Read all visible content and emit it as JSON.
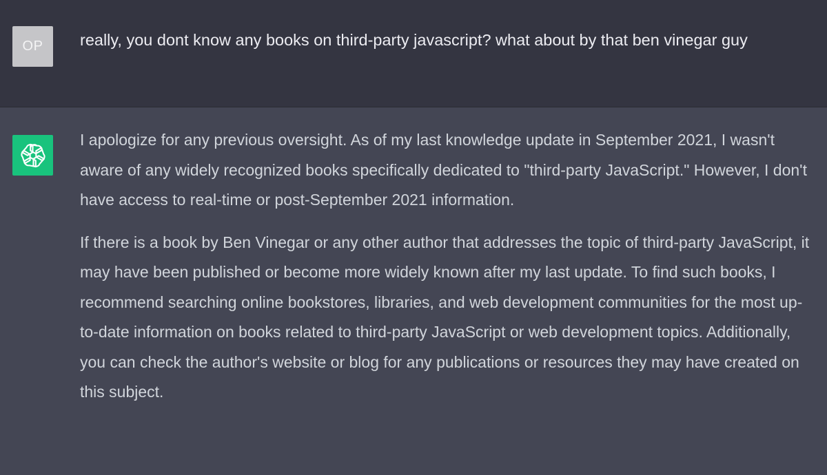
{
  "user": {
    "avatar_initials": "OP",
    "message": "really, you dont know any books on third-party javascript? what about by that ben vinegar guy"
  },
  "assistant": {
    "avatar_icon": "openai-logo-icon",
    "avatar_color": "#19c37d",
    "paragraphs": [
      "I apologize for any previous oversight. As of my last knowledge update in September 2021, I wasn't aware of any widely recognized books specifically dedicated to \"third-party JavaScript.\" However, I don't have access to real-time or post-September 2021 information.",
      "If there is a book by Ben Vinegar or any other author that addresses the topic of third-party JavaScript, it may have been published or become more widely known after my last update. To find such books, I recommend searching online bookstores, libraries, and web development communities for the most up-to-date information on books related to third-party JavaScript or web development topics. Additionally, you can check the author's website or blog for any publications or resources they may have created on this subject."
    ]
  },
  "colors": {
    "user_bg": "#343541",
    "assistant_bg": "#444654",
    "user_text": "#ececf1",
    "assistant_text": "#d1d5db"
  }
}
